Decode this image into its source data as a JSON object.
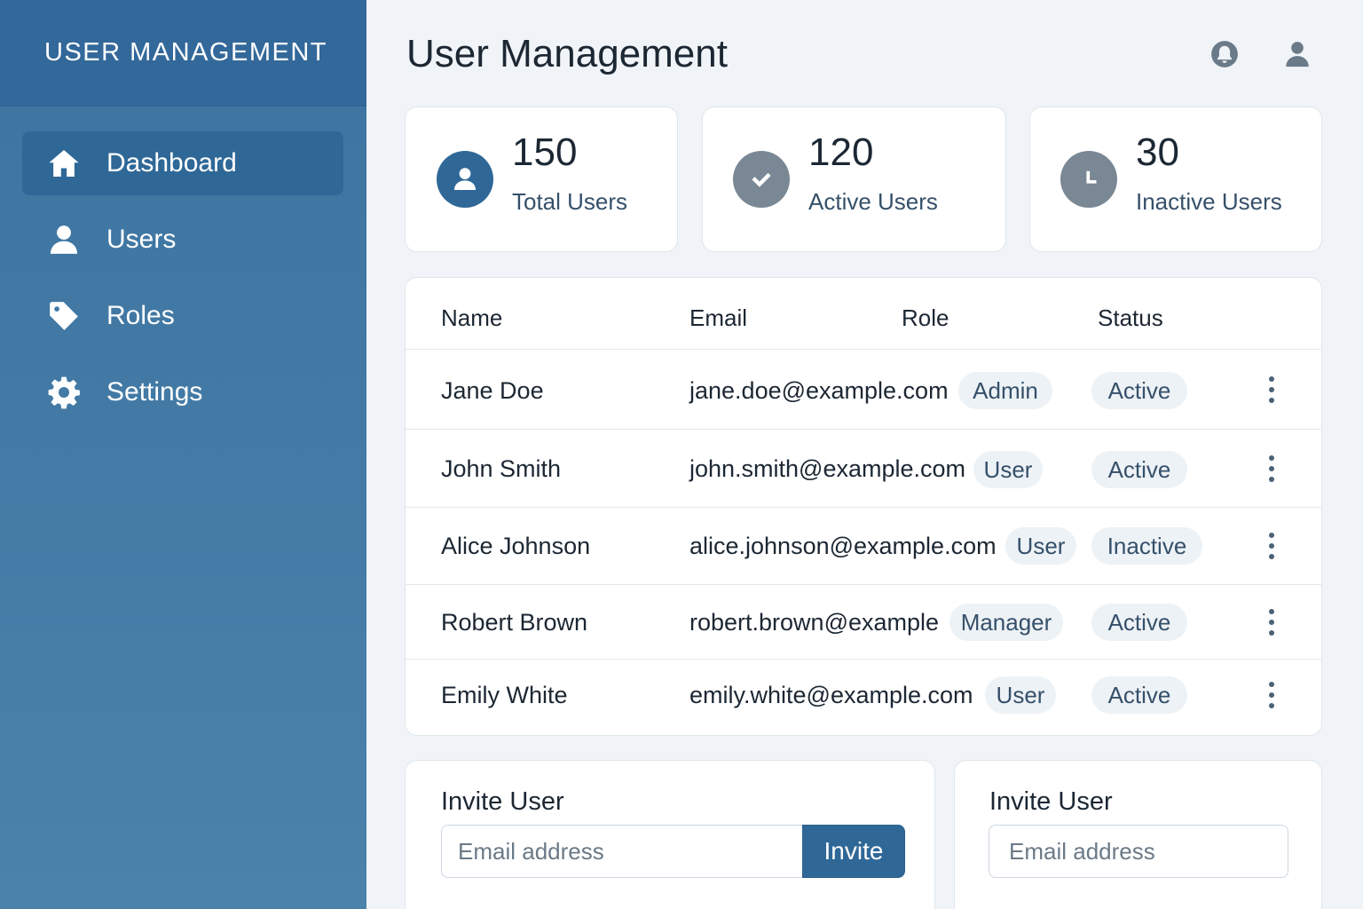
{
  "sidebar": {
    "title": "USER MANAGEMENT",
    "items": [
      {
        "label": "Dashboard",
        "icon": "home-icon",
        "active": true
      },
      {
        "label": "Users",
        "icon": "user-icon",
        "active": false
      },
      {
        "label": "Roles",
        "icon": "tag-icon",
        "active": false
      },
      {
        "label": "Settings",
        "icon": "gear-icon",
        "active": false
      }
    ]
  },
  "header": {
    "title": "User Management",
    "icons": [
      "bell-icon",
      "profile-icon"
    ]
  },
  "stats": [
    {
      "value": "150",
      "label": "Total Users",
      "icon": "user-icon",
      "color": "#2f6897"
    },
    {
      "value": "120",
      "label": "Active Users",
      "icon": "check-icon",
      "color": "#7a8794"
    },
    {
      "value": "30",
      "label": "Inactive Users",
      "icon": "clock-icon",
      "color": "#7a8794"
    }
  ],
  "table": {
    "columns": [
      "Name",
      "Email",
      "Role",
      "Status"
    ],
    "rows": [
      {
        "name": "Jane Doe",
        "email": "jane.doe@example.com",
        "role": "Admin",
        "status": "Active"
      },
      {
        "name": "John Smith",
        "email": "john.smith@example.com",
        "role": "User",
        "status": "Active"
      },
      {
        "name": "Alice Johnson",
        "email": "alice.johnson@example.com",
        "role": "User",
        "status": "Inactive"
      },
      {
        "name": "Robert Brown",
        "email": "robert.brown@example",
        "role": "Manager",
        "status": "Active"
      },
      {
        "name": "Emily White",
        "email": "emily.white@example.com",
        "role": "User",
        "status": "Active"
      }
    ]
  },
  "invite_left": {
    "title": "Invite User",
    "placeholder": "Email address",
    "button_label": "Invite"
  },
  "invite_right": {
    "title": "Invite User",
    "placeholder": "Email address"
  },
  "colors": {
    "accent": "#2f6897",
    "sidebar": "#3d73a0",
    "background": "#f0f4f8"
  }
}
